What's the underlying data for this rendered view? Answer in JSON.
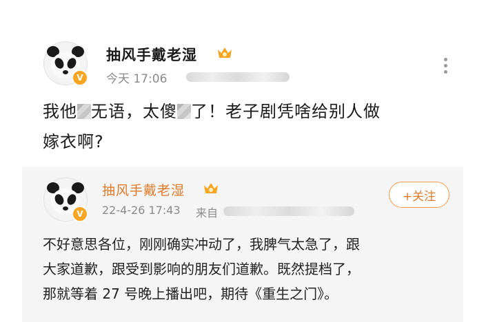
{
  "original_post": {
    "username": "抽风手戴老湿",
    "timestamp": "今天 17:06",
    "text_parts": [
      "我他",
      "无语，太傻",
      "了！老子剧凭啥给别人做",
      "嫁衣啊?"
    ]
  },
  "repost": {
    "username": "抽风手戴老湿",
    "timestamp": "22-4-26 17:43",
    "source_prefix": "来自",
    "follow_label": "+关注",
    "text_lines": [
      "不好意思各位，刚刚确实冲动了，我脾气太急了，跟",
      "大家道歉，跟受到影响的朋友们道歉。既然提档了，",
      "那就等着 27 号晚上播出吧，期待《重生之门》。"
    ]
  },
  "colors": {
    "accent_orange": "#f6a623",
    "follow_orange": "#e07a2a",
    "meta_gray": "#8a8a8a"
  },
  "icons": [
    "panda-avatar",
    "verified-badge",
    "crown-badge",
    "more-icon"
  ]
}
